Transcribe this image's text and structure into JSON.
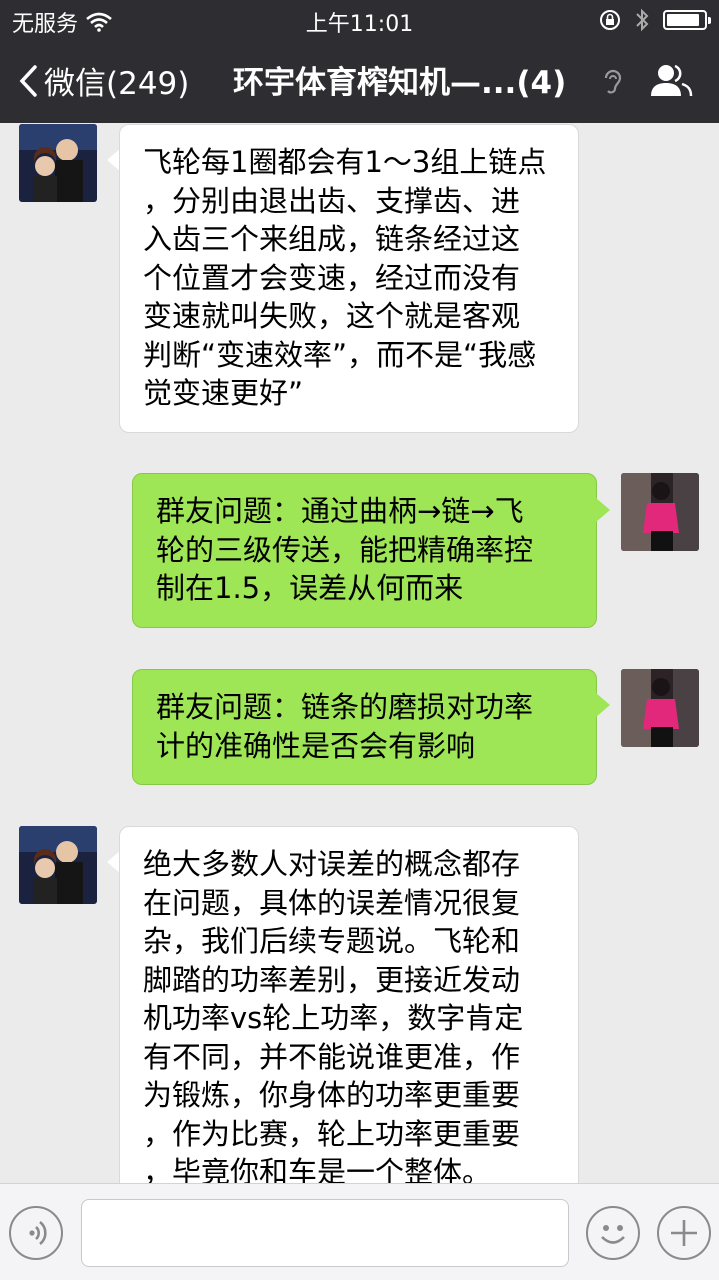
{
  "status_bar": {
    "carrier": "无服务",
    "time": "上午11:01",
    "battery_level": 0.9
  },
  "nav": {
    "back_label": "微信(249)",
    "title": "环宇体育榨知机—...(4)"
  },
  "messages": [
    {
      "side": "left",
      "lines": [
        "飞轮每1圈都会有1～3组上链点",
        "，分别由退出齿、支撑齿、进",
        "入齿三个来组成，链条经过这",
        "个位置才会变速，经过而没有",
        "变速就叫失败，这个就是客观",
        "判断“变速效率”，而不是“我感",
        "觉变速更好”"
      ]
    },
    {
      "side": "right",
      "lines": [
        "群友问题：通过曲柄→链→飞",
        "轮的三级传送，能把精确率控",
        "制在1.5，误差从何而来"
      ]
    },
    {
      "side": "right",
      "lines": [
        "群友问题：链条的磨损对功率",
        "计的准确性是否会有影响"
      ]
    },
    {
      "side": "left",
      "lines": [
        "绝大多数人对误差的概念都存",
        "在问题，具体的误差情况很复",
        "杂，我们后续专题说。飞轮和",
        "脚踏的功率差别，更接近发动",
        "机功率vs轮上功率，数字肯定",
        "有不同，并不能说谁更准，作",
        "为锻炼，你身体的功率更重要",
        "，作为比赛，轮上功率更重要",
        "，毕竟你和车是一个整体。"
      ]
    }
  ],
  "input": {
    "placeholder": ""
  },
  "colors": {
    "nav_bg": "#2e2d32",
    "chat_bg": "#ebebeb",
    "bubble_self": "#9ee655",
    "bubble_other": "#ffffff"
  }
}
